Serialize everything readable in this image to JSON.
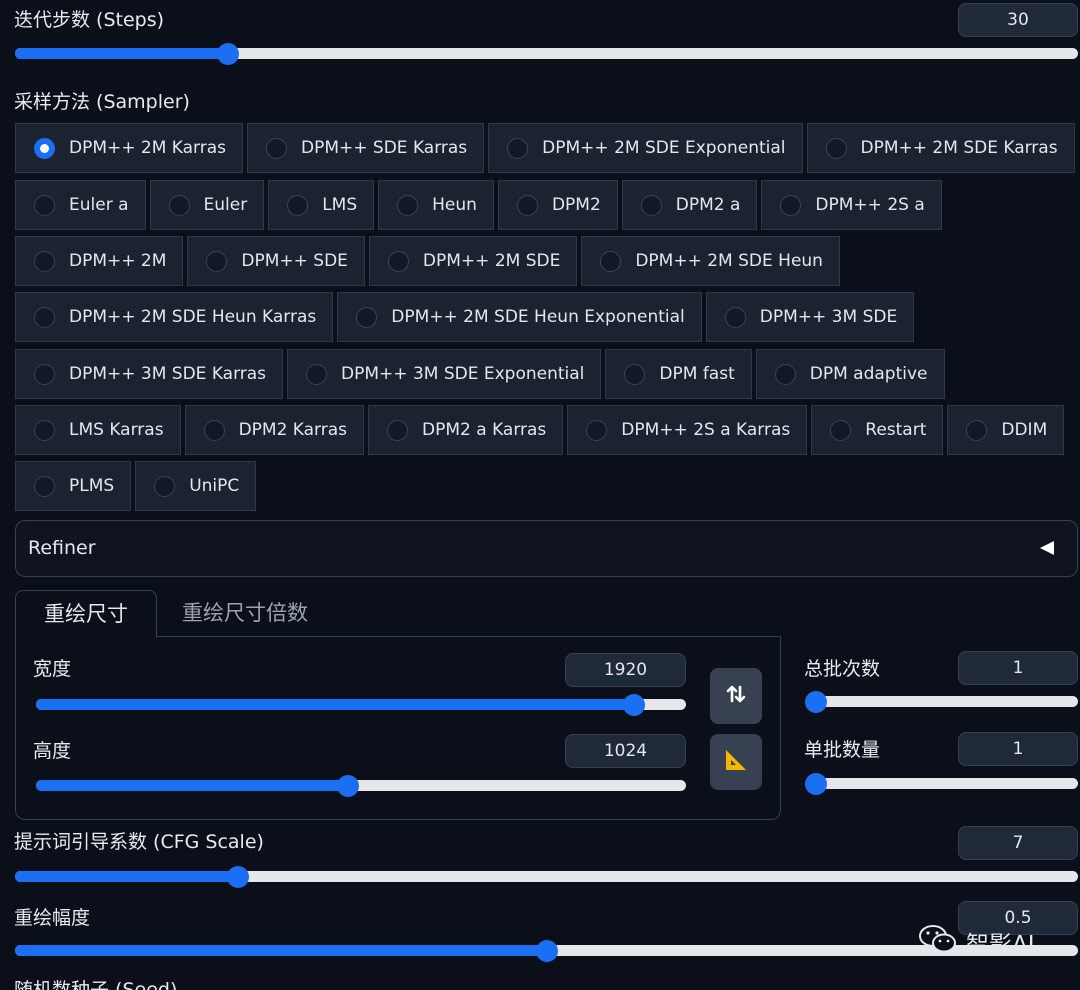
{
  "steps": {
    "label": "迭代步数 (Steps)",
    "value": "30",
    "fraction": 0.2
  },
  "sampler": {
    "label": "采样方法 (Sampler)",
    "selected": "DPM++ 2M Karras",
    "rows": [
      [
        "DPM++ 2M Karras",
        "DPM++ SDE Karras",
        "DPM++ 2M SDE Exponential",
        "DPM++ 2M SDE Karras"
      ],
      [
        "Euler a",
        "Euler",
        "LMS",
        "Heun",
        "DPM2",
        "DPM2 a",
        "DPM++ 2S a"
      ],
      [
        "DPM++ 2M",
        "DPM++ SDE",
        "DPM++ 2M SDE",
        "DPM++ 2M SDE Heun"
      ],
      [
        "DPM++ 2M SDE Heun Karras",
        "DPM++ 2M SDE Heun Exponential",
        "DPM++ 3M SDE"
      ],
      [
        "DPM++ 3M SDE Karras",
        "DPM++ 3M SDE Exponential",
        "DPM fast",
        "DPM adaptive"
      ],
      [
        "LMS Karras",
        "DPM2 Karras",
        "DPM2 a Karras",
        "DPM++ 2S a Karras",
        "Restart",
        "DDIM"
      ],
      [
        "PLMS",
        "UniPC"
      ]
    ]
  },
  "refiner": {
    "label": "Refiner",
    "icon": "triangle-left-icon"
  },
  "tabs": {
    "active": "重绘尺寸",
    "inactive": "重绘尺寸倍数"
  },
  "width": {
    "label": "宽度",
    "value": "1920",
    "fraction": 0.92
  },
  "height": {
    "label": "高度",
    "value": "1024",
    "fraction": 0.48
  },
  "swap_icon": "swap-arrows-icon",
  "ratio_icon": "set-square-icon",
  "batch_count": {
    "label": "总批次数",
    "value": "1",
    "fraction": 0.0
  },
  "batch_size": {
    "label": "单批数量",
    "value": "1",
    "fraction": 0.0
  },
  "cfg": {
    "label": "提示词引导系数 (CFG Scale)",
    "value": "7",
    "fraction": 0.21
  },
  "denoise": {
    "label": "重绘幅度",
    "value": "0.5",
    "fraction": 0.5
  },
  "seed": {
    "label": "随机数种子 (Seed)"
  },
  "watermark": {
    "text": "智影AI",
    "icon": "wechat-icon"
  },
  "colors": {
    "accent": "#1a6ff2",
    "background": "#0b0f19",
    "chip": "#1b2230"
  }
}
